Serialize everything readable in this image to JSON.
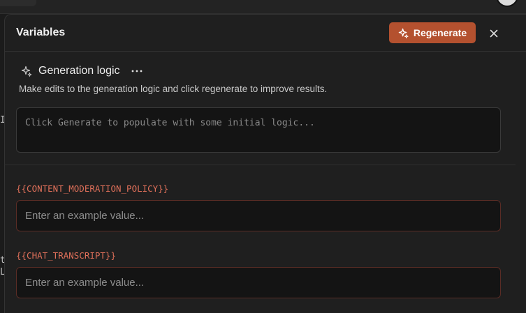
{
  "left_fragments": [
    "Ic",
    "t",
    "L"
  ],
  "panel": {
    "title": "Variables",
    "regenerate_label": "Regenerate"
  },
  "generation": {
    "title": "Generation logic",
    "more_label": "···",
    "description": "Make edits to the generation logic and click regenerate to improve results.",
    "placeholder": "Click Generate to populate with some initial logic..."
  },
  "variables": [
    {
      "name": "{{CONTENT_MODERATION_POLICY}}",
      "placeholder": "Enter an example value..."
    },
    {
      "name": "{{CHAT_TRANSCRIPT}}",
      "placeholder": "Enter an example value..."
    }
  ],
  "colors": {
    "accent": "#b4512f",
    "variable_label": "#e0705a",
    "background": "#1f1f1f"
  }
}
